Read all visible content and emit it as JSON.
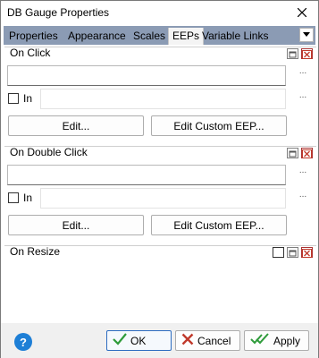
{
  "window": {
    "title": "DB Gauge Properties"
  },
  "tabs": [
    {
      "label": "Properties",
      "active": false
    },
    {
      "label": "Appearance",
      "active": false
    },
    {
      "label": "Scales",
      "active": false
    },
    {
      "label": "EEPs",
      "active": true
    },
    {
      "label": "Variable Links",
      "active": false
    }
  ],
  "sections": {
    "on_click": {
      "title": "On Click",
      "text_value": "",
      "in_label": "In",
      "in_checked": false,
      "in_value": "",
      "ellipsis": "...",
      "edit_label": "Edit...",
      "edit_custom_label": "Edit Custom EEP..."
    },
    "on_double_click": {
      "title": "On Double Click",
      "text_value": "",
      "in_label": "In",
      "in_checked": false,
      "in_value": "",
      "ellipsis": "...",
      "edit_label": "Edit...",
      "edit_custom_label": "Edit Custom EEP..."
    },
    "on_resize": {
      "title": "On Resize"
    }
  },
  "footer": {
    "help_glyph": "?",
    "ok_label": "OK",
    "cancel_label": "Cancel",
    "apply_label": "Apply"
  },
  "colors": {
    "tabbar": "#8b9bb4",
    "close_red": "#c0392b",
    "check_green": "#2e9b3a",
    "help_blue": "#1e7fd6"
  }
}
